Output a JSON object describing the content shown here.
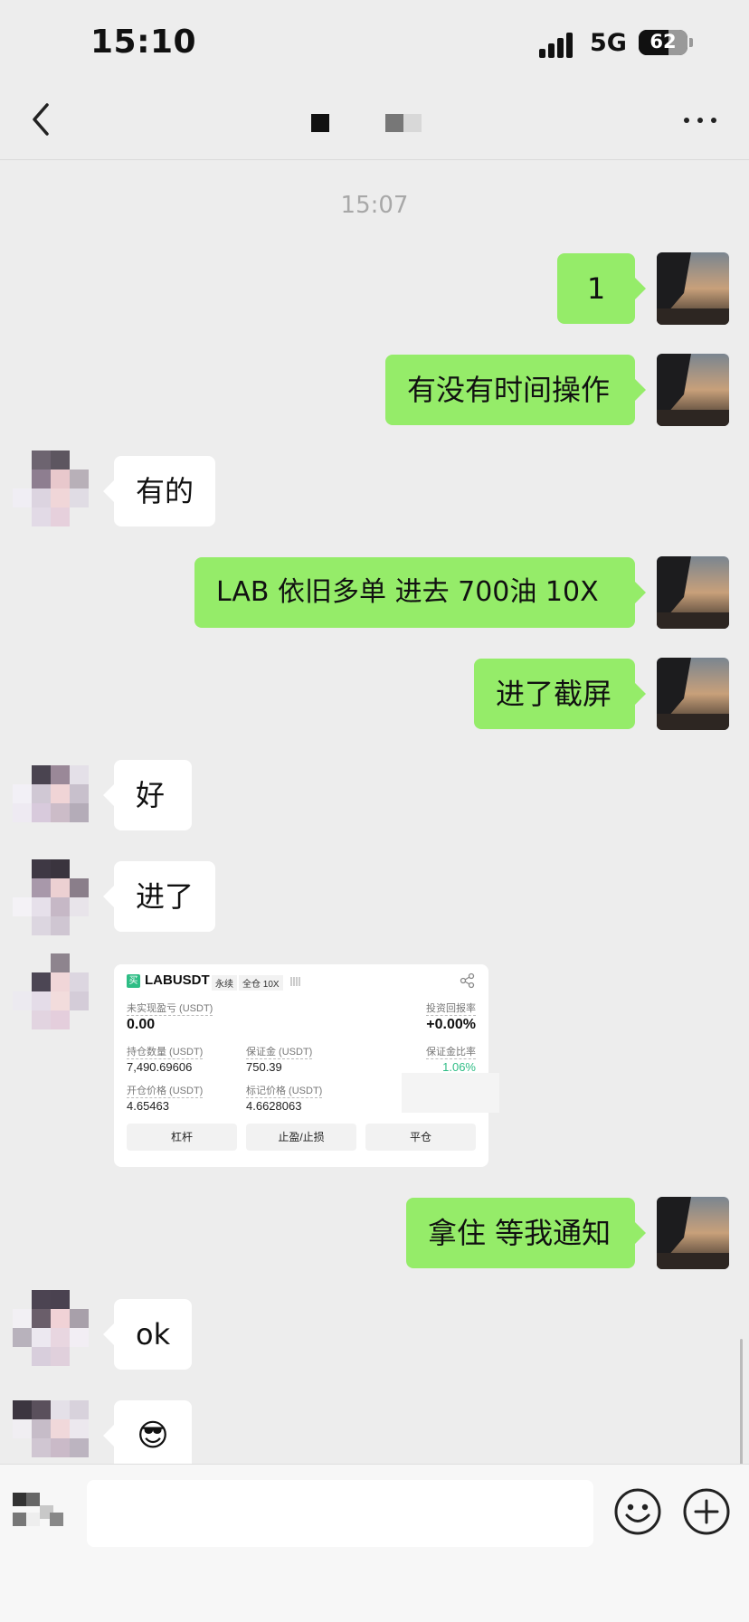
{
  "status": {
    "time": "15:10",
    "network": "5G",
    "battery": "62",
    "battery_level_pct": 62
  },
  "chat": {
    "title_redacted": true,
    "timestamp": "15:07",
    "messages": [
      {
        "side": "me",
        "text": "1"
      },
      {
        "side": "me",
        "text": "有没有时间操作"
      },
      {
        "side": "them",
        "text": "有的"
      },
      {
        "side": "me",
        "text": "LAB 依旧多单 进去 700油 10X"
      },
      {
        "side": "me",
        "text": "进了截屏"
      },
      {
        "side": "them",
        "text": "好"
      },
      {
        "side": "them",
        "text": "进了"
      },
      {
        "side": "them",
        "type": "image"
      },
      {
        "side": "me",
        "text": "拿住 等我通知"
      },
      {
        "side": "them",
        "text": "ok"
      },
      {
        "side": "them",
        "text": "😎"
      }
    ]
  },
  "trade_card": {
    "badge": "买",
    "symbol": "LABUSDT",
    "tag1": "永续",
    "tag2": "全仓 10X",
    "pnl_label": "未实现盈亏 (USDT)",
    "pnl_value": "0.00",
    "roi_label": "投资回报率",
    "roi_value": "+0.00%",
    "size_label": "持仓数量 (USDT)",
    "size_value": "7,490.69606",
    "margin_label": "保证金 (USDT)",
    "margin_value": "750.39",
    "margin_ratio_label": "保证金比率",
    "margin_ratio_value": "1.06%",
    "entry_label": "开仓价格 (USDT)",
    "entry_value": "4.65463",
    "mark_label": "标记价格 (USDT)",
    "mark_value": "4.6628063",
    "btn1": "杠杆",
    "btn2": "止盈/止损",
    "btn3": "平仓"
  },
  "input": {
    "value": ""
  },
  "colors": {
    "my_bubble": "#95ec69",
    "their_bubble": "#ffffff",
    "background": "#ededed",
    "ratio_green": "#2ebd85"
  },
  "icons": [
    "back-icon",
    "more-icon",
    "share-icon",
    "voice-icon",
    "emoji-icon",
    "plus-icon"
  ]
}
